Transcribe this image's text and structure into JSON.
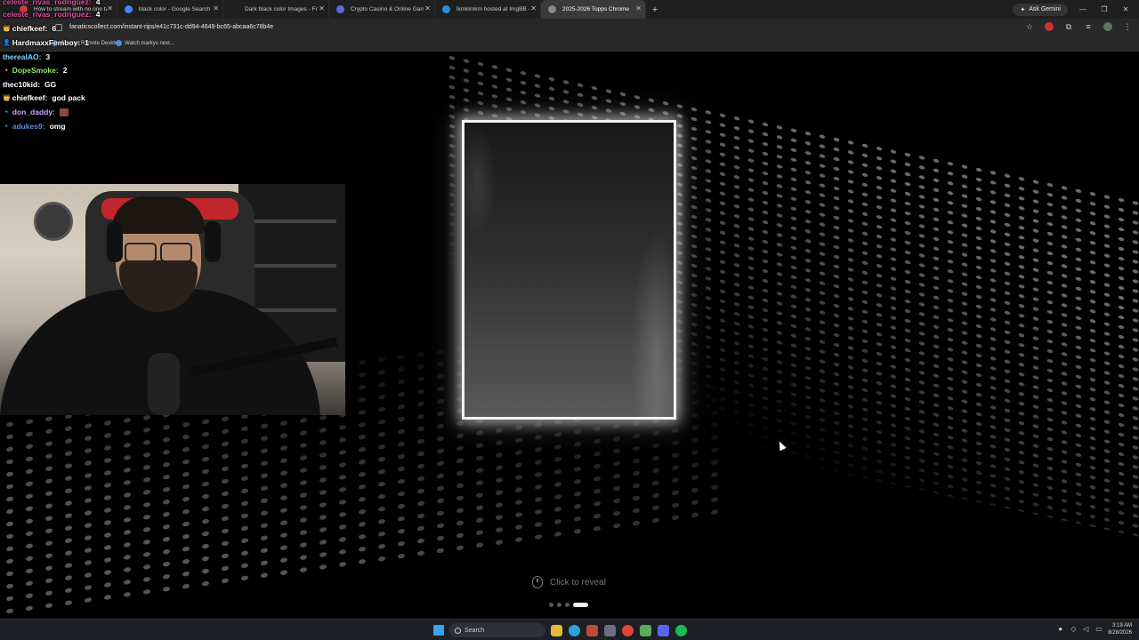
{
  "browser": {
    "tabs": [
      {
        "label": "How to stream with no one talk",
        "color": "#d23b3b",
        "active": false
      },
      {
        "label": "black color - Google Search",
        "color": "#4285f4",
        "active": false
      },
      {
        "label": "Dark black color Images - Free",
        "color": "#1f1f1f",
        "active": false
      },
      {
        "label": "Crypto Casino & Online Gambl",
        "color": "#5a6bd8",
        "active": false
      },
      {
        "label": "lkmklmkm hosted at ImgBB —",
        "color": "#2a8fd6",
        "active": false
      },
      {
        "label": "2025-2026 Topps Chrome",
        "color": "#888888",
        "active": true
      }
    ],
    "new_tab": "+",
    "ask_gemini": "Ask Gemini",
    "url": "fanaticscollect.com/instant-rips/e41c731c-dd94-4649-bc65-abcaa6c78b4e",
    "bookmarks": [
      {
        "label": "Chrome Remote Desktop"
      },
      {
        "label": "Watch markys next..."
      }
    ]
  },
  "chat": [
    {
      "user": "celeste_rivas_rodriguez",
      "msg": "4",
      "color": "#e04fa0",
      "badge": ""
    },
    {
      "user": "celeste_rivas_rodriguez",
      "msg": "4",
      "color": "#e04fa0",
      "badge": ""
    },
    {
      "user": "chiefkeef",
      "msg": "6",
      "color": "#ffffff",
      "badge": "👑"
    },
    {
      "user": "HardmaxxFemboy",
      "msg": "1",
      "color": "#ffffff",
      "badge": "👤"
    },
    {
      "user": "therealAO",
      "msg": "3",
      "color": "#7fd3ff",
      "badge": ""
    },
    {
      "user": "DopeSmoke",
      "msg": "2",
      "color": "#9ae65c",
      "badge": "🔸"
    },
    {
      "user": "thec10kid",
      "msg": "GG",
      "color": "#ffffff",
      "badge": ""
    },
    {
      "user": "chiefkeef",
      "msg": "god pack",
      "color": "#ffffff",
      "badge": "👑"
    },
    {
      "user": "don_daddy",
      "msg": "",
      "color": "#c9a7ff",
      "badge": "🔹",
      "emote": true
    },
    {
      "user": "adukes9",
      "msg": "omg",
      "color": "#5e8fd6",
      "badge": "🔹"
    }
  ],
  "page": {
    "cta": "Click to reveal",
    "pager": {
      "total": 4,
      "active_index": 3
    }
  },
  "taskbar": {
    "search": "Search",
    "time": "3:19 AM",
    "date": "8/28/2026",
    "apps": [
      {
        "name": "start",
        "color": "#3aa0f3"
      },
      {
        "name": "files",
        "color": "#e8b73a"
      },
      {
        "name": "edge",
        "color": "#2ea3d8"
      },
      {
        "name": "app3",
        "color": "#c04a3a"
      },
      {
        "name": "app4",
        "color": "#6a7080"
      },
      {
        "name": "chrome",
        "color": "#e0453a"
      },
      {
        "name": "app6",
        "color": "#5caa5a"
      },
      {
        "name": "discord",
        "color": "#5865f2"
      },
      {
        "name": "spotify",
        "color": "#1db954"
      }
    ]
  }
}
